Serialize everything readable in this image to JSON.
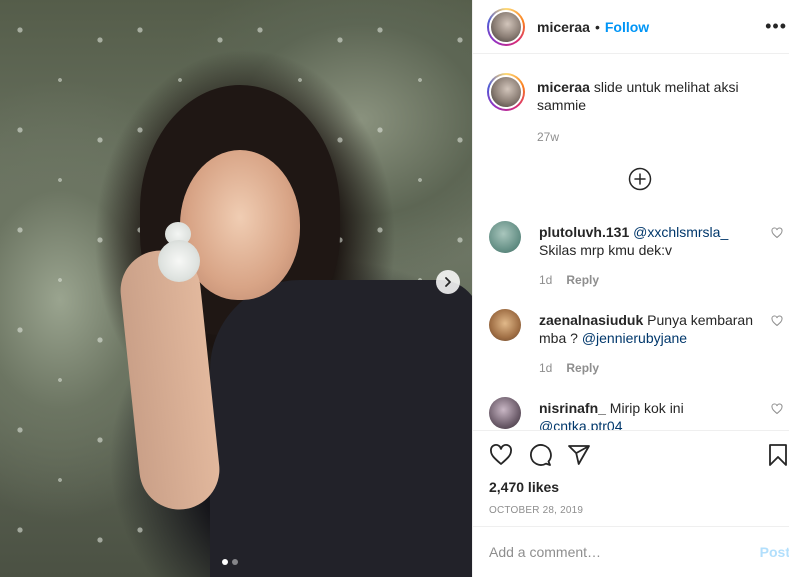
{
  "post": {
    "author": "miceraa",
    "follow_label": "Follow",
    "separator": "•",
    "more_label": "•••"
  },
  "caption": {
    "username": "miceraa",
    "text": "slide untuk melihat aksi sammie",
    "time": "27w"
  },
  "comments": [
    {
      "username": "plutoluvh.131",
      "mention": "@xxchlsmrsla_",
      "text": "Skilas mrp kmu dek:v",
      "time": "1d",
      "reply_label": "Reply",
      "avatar_color": "#7fa49a"
    },
    {
      "username": "zaenalnasiuduk",
      "text": "Punya kembaran mba ?",
      "mention": "@jennierubyjane",
      "time": "1d",
      "reply_label": "Reply",
      "avatar_color": "#a07a52"
    },
    {
      "username": "nisrinafn_",
      "text": "Mirip kok ini",
      "mention": "@cntka.ptr04",
      "time": "",
      "reply_label": "",
      "avatar_color": "#6d5d6b"
    }
  ],
  "likes": "2,470 likes",
  "date": "OCTOBER 28, 2019",
  "add_comment": {
    "placeholder": "Add a comment…",
    "post_label": "Post"
  },
  "carousel": {
    "count": 2,
    "active_index": 0
  },
  "icons": {
    "carousel_next": "chevron-right-icon",
    "load_more": "plus-circle-icon",
    "like": "heart-icon",
    "comment": "comment-icon",
    "share": "paper-plane-icon",
    "save": "bookmark-icon"
  },
  "colors": {
    "accent": "#0095f6",
    "muted": "#8e8e8e",
    "text": "#262626",
    "post_disabled": "#b2dffc",
    "link": "#00376b"
  }
}
